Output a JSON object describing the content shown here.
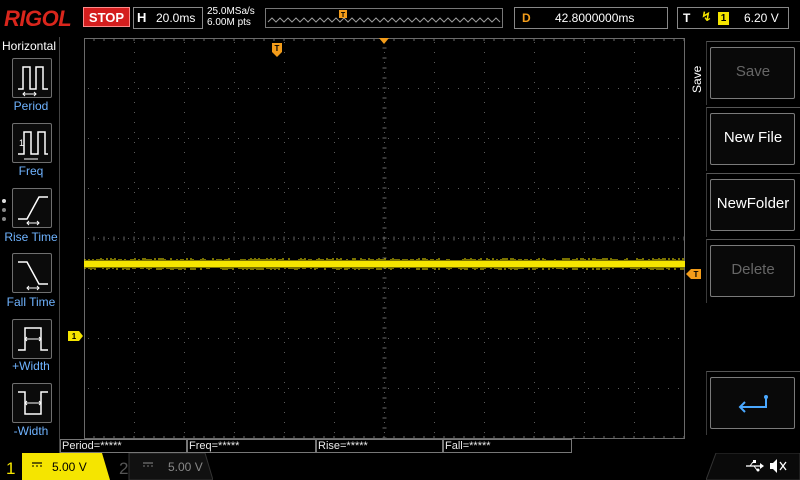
{
  "header": {
    "logo_text": "RIGOL",
    "run_status": "STOP",
    "timebase_label": "H",
    "timebase_value": "20.0ms",
    "sample_rate": "25.0MSa/s",
    "memory_depth": "6.00M pts",
    "delay_label": "D",
    "delay_value": "42.8000000ms",
    "trigger_label": "T",
    "trigger_source": "1",
    "trigger_level": "6.20 V"
  },
  "left_panel": {
    "title": "Horizontal",
    "items": [
      {
        "label": "Period",
        "icon": "period-icon"
      },
      {
        "label": "Freq",
        "icon": "freq-icon"
      },
      {
        "label": "Rise Time",
        "icon": "rise-time-icon"
      },
      {
        "label": "Fall Time",
        "icon": "fall-time-icon"
      },
      {
        "label": "+Width",
        "icon": "positive-width-icon"
      },
      {
        "label": "-Width",
        "icon": "negative-width-icon"
      }
    ]
  },
  "right_menu": {
    "title": "Save",
    "items": [
      {
        "label": "Save",
        "enabled": false
      },
      {
        "label": "New File",
        "enabled": true
      },
      {
        "label": "NewFolder",
        "enabled": true
      },
      {
        "label": "Delete",
        "enabled": false
      }
    ],
    "return_icon": "return-arrow-icon"
  },
  "measurements": {
    "period": "Period=*****",
    "freq": "Freq=*****",
    "rise": "Rise=*****",
    "fall": "Fall=*****"
  },
  "channels": [
    {
      "number": "1",
      "coupling_icon": "dc-coupling-icon",
      "scale": "5.00 V",
      "active": true
    },
    {
      "number": "2",
      "coupling_icon": "dc-coupling-icon",
      "scale": "5.00 V",
      "active": false
    }
  ],
  "markers": {
    "trigger_position_label": "T",
    "trigger_level_label": "T",
    "channel1_ground_label": "1"
  },
  "status_icons": [
    "usb-icon",
    "speaker-muted-icon"
  ],
  "colors": {
    "channel1": "#f5e500",
    "channel2": "#2aa6a6",
    "stop": "#d41e1e",
    "trigger_marker": "#f39c1a",
    "menu_label": "#6fb3ff",
    "logo": "#d9261c"
  }
}
